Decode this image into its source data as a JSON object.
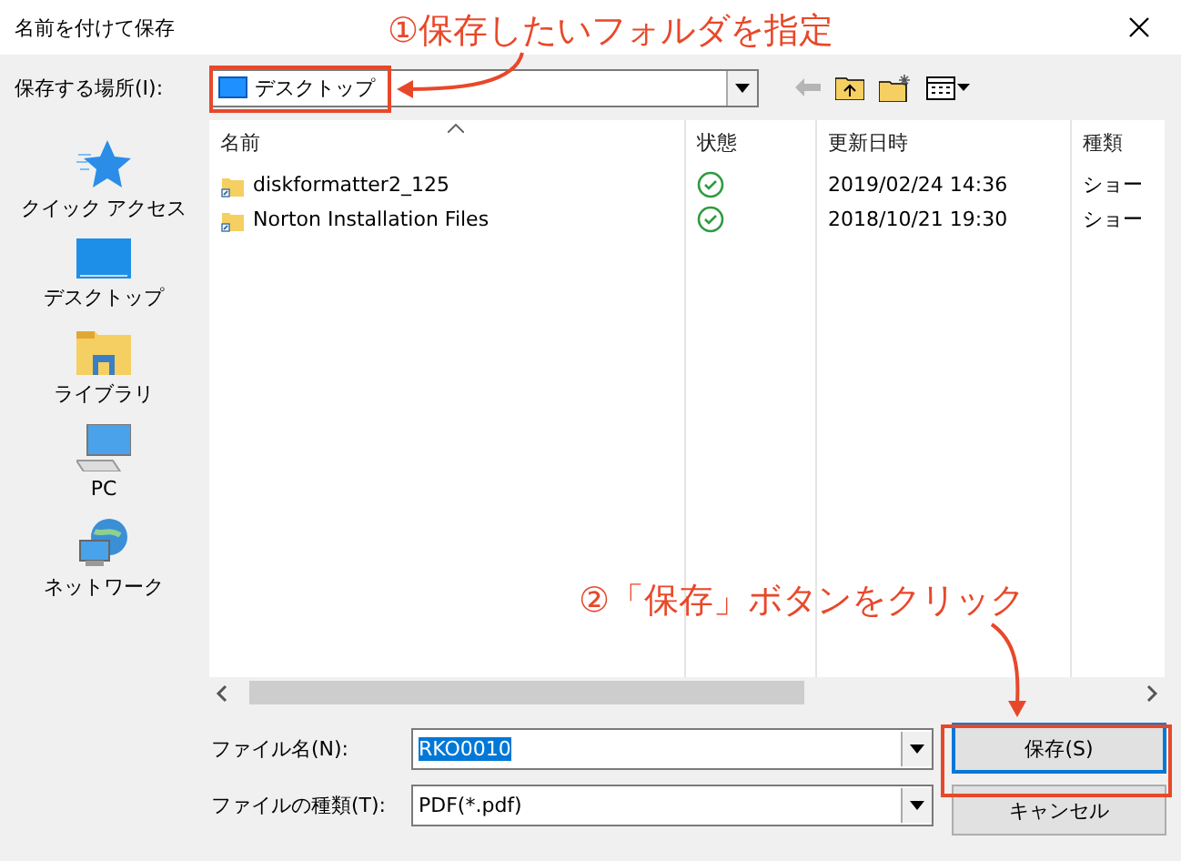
{
  "window": {
    "title": "名前を付けて保存"
  },
  "location": {
    "label": "保存する場所(I):",
    "value": "デスクトップ"
  },
  "sidebar": {
    "items": [
      {
        "kind": "quick",
        "label": "クイック アクセス"
      },
      {
        "kind": "desktop",
        "label": "デスクトップ"
      },
      {
        "kind": "library",
        "label": "ライブラリ"
      },
      {
        "kind": "pc",
        "label": "PC"
      },
      {
        "kind": "network",
        "label": "ネットワーク"
      }
    ]
  },
  "table": {
    "columns": [
      "名前",
      "状態",
      "更新日時",
      "種類"
    ],
    "rows": [
      {
        "name": "diskformatter2_125",
        "synced": true,
        "modified": "2019/02/24 14:36",
        "type": "ショー"
      },
      {
        "name": "Norton Installation Files",
        "synced": true,
        "modified": "2018/10/21 19:30",
        "type": "ショー"
      }
    ]
  },
  "file_name": {
    "label": "ファイル名(N):",
    "value": "RKO0010",
    "selected": true
  },
  "file_type": {
    "label": "ファイルの種類(T):",
    "value": "PDF(*.pdf)"
  },
  "buttons": [
    "保存(S)",
    "キャンセル"
  ],
  "annotations": [
    {
      "text": "①保存したいフォルダを指定"
    },
    {
      "text": "②「保存」ボタンをクリック"
    }
  ]
}
